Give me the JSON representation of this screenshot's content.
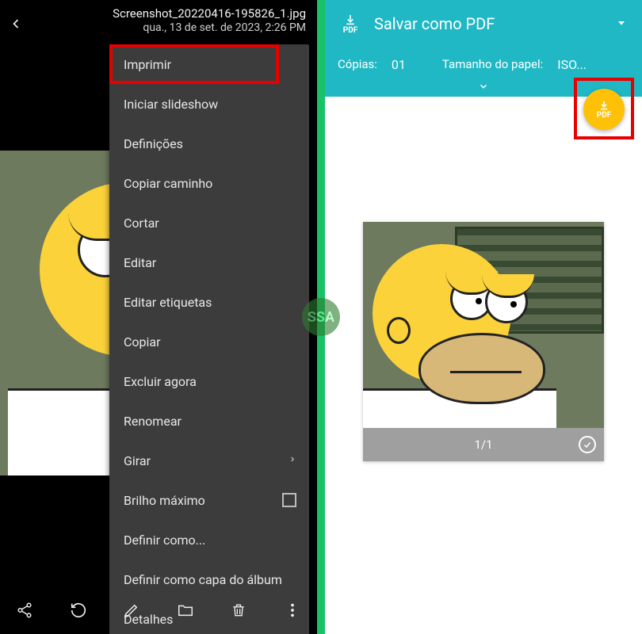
{
  "left": {
    "topbar": {
      "filename": "Screenshot_20220416-195826_1.jpg",
      "datetime": "qua., 13 de set. de 2023, 2:26 PM"
    },
    "menu": {
      "items": [
        {
          "label": "Imprimir"
        },
        {
          "label": "Iniciar slideshow"
        },
        {
          "label": "Definições"
        },
        {
          "label": "Copiar caminho"
        },
        {
          "label": "Cortar"
        },
        {
          "label": "Editar"
        },
        {
          "label": "Editar etiquetas"
        },
        {
          "label": "Copiar"
        },
        {
          "label": "Excluir agora"
        },
        {
          "label": "Renomear"
        },
        {
          "label": "Girar",
          "submenu": true
        },
        {
          "label": "Brilho máximo",
          "checkbox": true
        },
        {
          "label": "Definir como..."
        },
        {
          "label": "Definir como capa do álbum"
        },
        {
          "label": "Detalhes"
        }
      ]
    },
    "bottombar": {
      "icons": [
        "share",
        "reload",
        "edit",
        "folder",
        "delete",
        "more"
      ]
    }
  },
  "right": {
    "header": {
      "pdf_icon_text": "PDF",
      "title": "Salvar como PDF"
    },
    "options": {
      "copies_label": "Cópias:",
      "copies_value": "01",
      "paper_label": "Tamanho do papel:",
      "paper_value": "ISO..."
    },
    "fab": {
      "icon_text": "PDF"
    },
    "preview": {
      "page_indicator": "1/1"
    }
  },
  "watermark": {
    "text": "SSA"
  }
}
